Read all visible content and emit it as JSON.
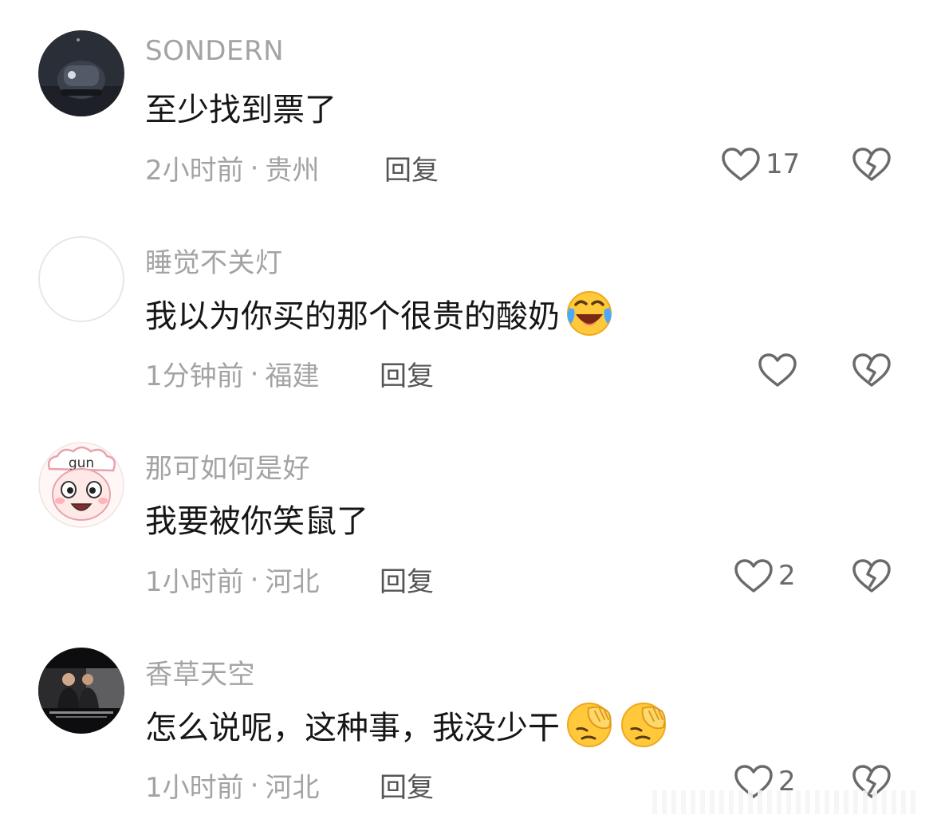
{
  "comments": [
    {
      "username": "SONDERN",
      "text": "至少找到票了",
      "time": "2小时前",
      "location": "贵州",
      "reply_label": "回复",
      "likes": "17",
      "avatar_icon": "dark-device-avatar",
      "emojis": []
    },
    {
      "username": "睡觉不关灯",
      "text": "我以为你买的那个很贵的酸奶",
      "time": "1分钟前",
      "location": "福建",
      "reply_label": "回复",
      "likes": "",
      "avatar_icon": "blank-avatar",
      "emojis": [
        "laughing-crying-emoji"
      ]
    },
    {
      "username": "那可如何是好",
      "text": "我要被你笑鼠了",
      "time": "1小时前",
      "location": "河北",
      "reply_label": "回复",
      "likes": "2",
      "avatar_icon": "cartoon-sheep-avatar",
      "avatar_label": "gun",
      "emojis": []
    },
    {
      "username": "香草天空",
      "text": "怎么说呢，这种事，我没少干",
      "time": "1小时前",
      "location": "河北",
      "reply_label": "回复",
      "likes": "2",
      "avatar_icon": "two-men-photo-avatar",
      "emojis": [
        "facepalm-emoji",
        "facepalm-emoji"
      ]
    }
  ],
  "separator": "·",
  "colors": {
    "username": "#a3a3a3",
    "text": "#161616",
    "meta": "#a3a3a3",
    "reply": "#555555",
    "icon": "#6a6a6a"
  }
}
